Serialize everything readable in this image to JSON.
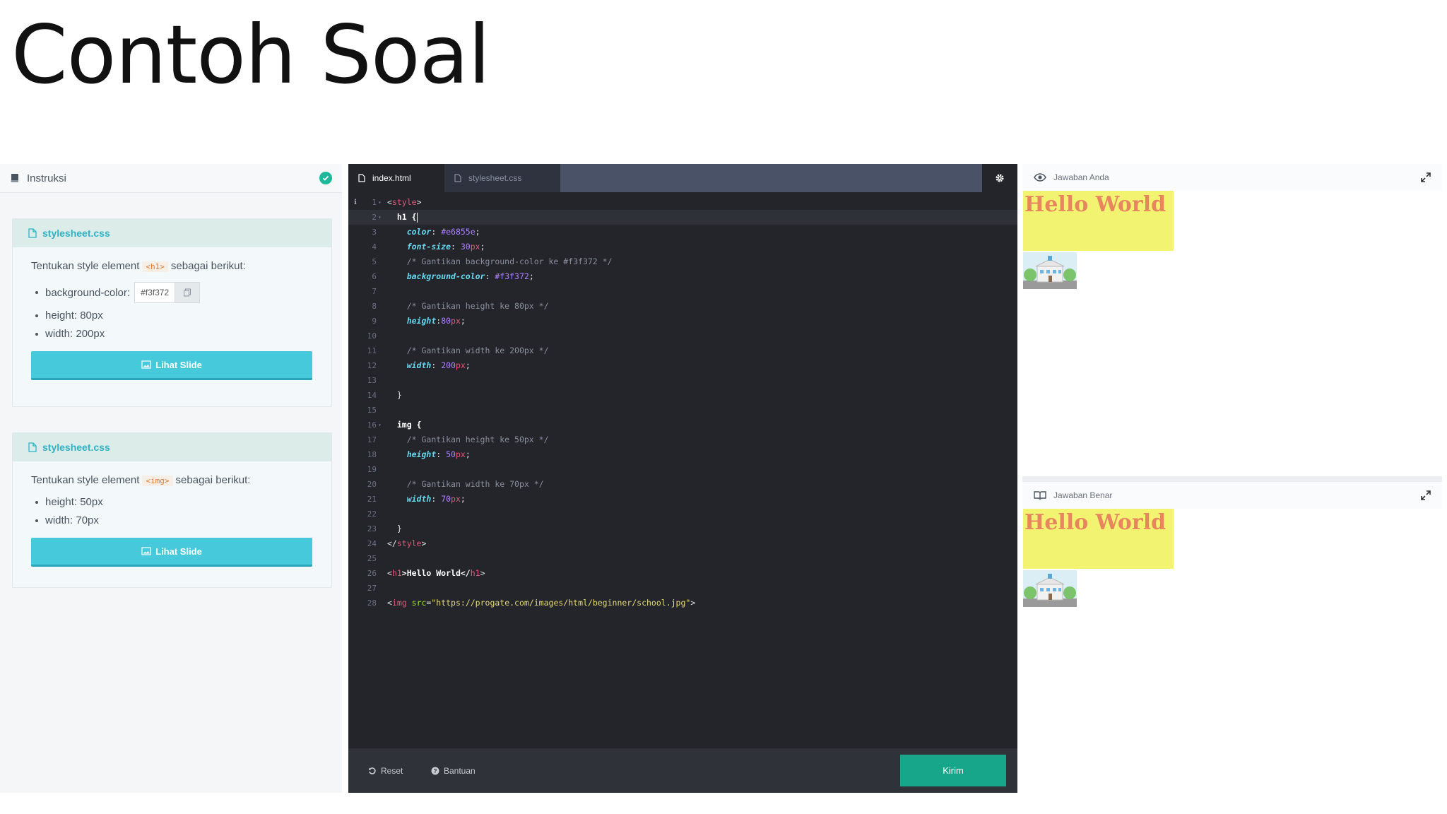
{
  "slide": {
    "title": "Contoh Soal"
  },
  "instructions": {
    "header": "Instruksi",
    "cards": [
      {
        "file": "stylesheet.css",
        "intro_before": "Tentukan style element",
        "tag": "<h1>",
        "intro_after": "sebagai berikut:",
        "bullet_bg_label": "background-color:",
        "bullet_bg_value": "#f3f372",
        "bullet_2": "height: 80px",
        "bullet_3": "width: 200px",
        "button": "Lihat Slide"
      },
      {
        "file": "stylesheet.css",
        "intro_before": "Tentukan style element",
        "tag": "<img>",
        "intro_after": "sebagai berikut:",
        "bullet_1": "height: 50px",
        "bullet_2": "width: 70px",
        "button": "Lihat Slide"
      }
    ]
  },
  "editor": {
    "tabs": [
      {
        "label": "index.html"
      },
      {
        "label": "stylesheet.css"
      }
    ],
    "footer": {
      "reset": "Reset",
      "help": "Bantuan",
      "submit": "Kirim"
    },
    "colors": {
      "background": "#23252b",
      "tabbar": "#4a5268",
      "submit": "#18a68a"
    },
    "line_numbers": [
      "1",
      "2",
      "3",
      "4",
      "5",
      "6",
      "7",
      "8",
      "9",
      "10",
      "11",
      "12",
      "13",
      "14",
      "15",
      "16",
      "17",
      "18",
      "19",
      "20",
      "21",
      "22",
      "23",
      "24",
      "25",
      "26",
      "27",
      "28"
    ],
    "code": {
      "l1_open": "<",
      "l1_tag": "style",
      "l1_close": ">",
      "l2": "h1 {",
      "l3_prop": "color",
      "l3_val": "#e6855e",
      "l4_prop": "font-size",
      "l4_num": "30",
      "l4_unit": "px",
      "l5": "/* Gantikan background-color ke #f3f372 */",
      "l6_prop": "background-color",
      "l6_val": "#f3f372",
      "l8": "/* Gantikan height ke 80px */",
      "l9_prop": "height",
      "l9_num": "80",
      "l9_unit": "px",
      "l11": "/* Gantikan width ke 200px */",
      "l12_prop": "width",
      "l12_num": "200",
      "l12_unit": "px",
      "l14": "}",
      "l16": "img {",
      "l17": "/* Gantikan height ke 50px */",
      "l18_prop": "height",
      "l18_num": "50",
      "l18_unit": "px",
      "l20": "/* Gantikan width ke 70px */",
      "l21_prop": "width",
      "l21_num": "70",
      "l21_unit": "px",
      "l23": "}",
      "l24_open": "</",
      "l24_tag": "style",
      "l24_close": ">",
      "l26_open": "<",
      "l26_tag": "h1",
      "l26_text": ">Hello World</",
      "l26_tag2": "h1",
      "l26_close": ">",
      "l28_open": "<",
      "l28_tag": "img",
      "l28_attr": " src",
      "l28_eq": "=",
      "l28_str": "\"https://progate.com/images/html/beginner/school.jpg\"",
      "l28_close": ">"
    }
  },
  "preview": {
    "yours": {
      "label": "Jawaban Anda",
      "heading": "Hello World"
    },
    "correct": {
      "label": "Jawaban Benar",
      "heading": "Hello World"
    },
    "colors": {
      "h1_background": "#f3f372",
      "h1_color": "#e6855e"
    }
  }
}
